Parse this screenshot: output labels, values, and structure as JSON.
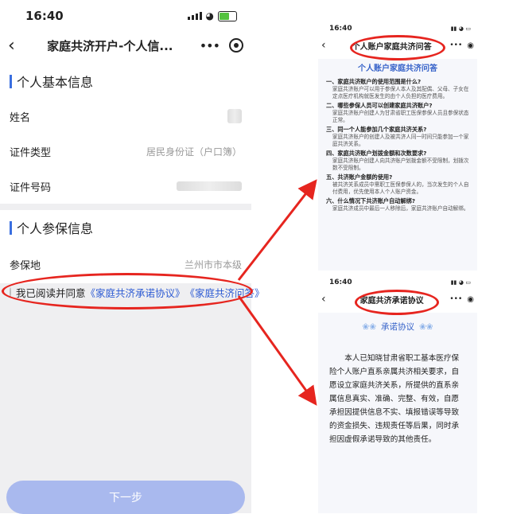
{
  "left": {
    "time": "16:40",
    "nav_title": "家庭共济开户-个人信...",
    "personal_section": "个人基本信息",
    "fields": [
      {
        "label": "姓名",
        "value": ""
      },
      {
        "label": "证件类型",
        "value": "居民身份证（户口簿）"
      },
      {
        "label": "证件号码",
        "value": ""
      }
    ],
    "insured_section": "个人参保信息",
    "insured_fields": [
      {
        "label": "参保地",
        "value": "兰州市市本级"
      }
    ],
    "agree_prefix": "我已阅读并同意",
    "agree_link1": "《家庭共济承诺协议》",
    "agree_link2": "《家庭共济问答》",
    "next_button": "下一步"
  },
  "faq_phone": {
    "time": "16:40",
    "nav_title": "个人账户家庭共济问答",
    "heading": "个人账户家庭共济问答",
    "items": [
      {
        "q": "一、家庭共济账户的使用范围是什么?",
        "a": "家庭共济账户可以用于参保人本人及其配偶、父母、子女在定点医疗机构就医发生的由个人负担的医疗费用。"
      },
      {
        "q": "二、哪些参保人员可以创建家庭共济账户?",
        "a": "家庭共济账户创建人为甘肃省职工医保参保人员且参保状态正常。"
      },
      {
        "q": "三、同一个人能参加几个家庭共济关系?",
        "a": "家庭共济账户的创建人及被共济人同一时间只能参加一个家庭共济关系。"
      },
      {
        "q": "四、家庭共济账户划拨金额和次数要求?",
        "a": "家庭共济账户创建人向共济账户划拨金额不受限制，划拨次数不受限制。"
      },
      {
        "q": "五、共济账户金额的使用?",
        "a": "被共济关系成员中需职工医保参保人的，当次发生的个人自付费用，优先使用本人个人账户资金。"
      },
      {
        "q": "六、什么情况下共济账户自动解绑?",
        "a": "家庭共济成员中最后一人移除后，家庭共济账户自动解绑。"
      }
    ]
  },
  "pledge_phone": {
    "time": "16:40",
    "nav_title": "家庭共济承诺协议",
    "heading": "承诺协议",
    "body": "本人已知晓甘肃省职工基本医疗保险个人账户直系亲属共济相关要求，自愿设立家庭共济关系，所提供的直系亲属信息真实、准确、完整、有效，自愿承担因提供信息不实、填报错误等导致的资金损失、违规责任等后果，同时承担因虚假承诺导致的其他责任。"
  },
  "colors": {
    "accent": "#3a6fe0",
    "link": "#2c5ad3",
    "highlight": "#e6251f",
    "button": "#a9b9ee"
  }
}
